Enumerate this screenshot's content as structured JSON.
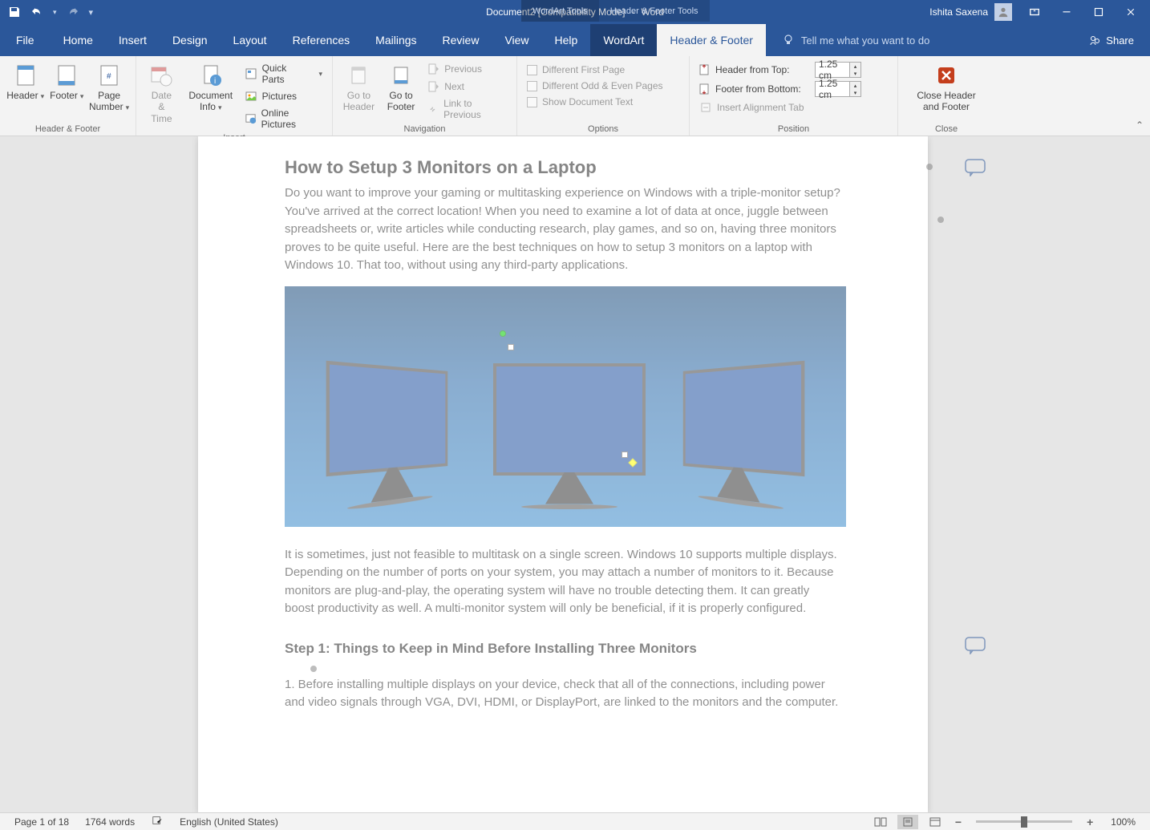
{
  "title": {
    "doc": "Document2 [Compatibility Mode]",
    "app": "Word",
    "sep": "-"
  },
  "context_tabs": {
    "wordart": "WordArt Tools",
    "headerfooter": "Header & Footer Tools"
  },
  "user": {
    "name": "Ishita Saxena"
  },
  "tabs": {
    "file": "File",
    "home": "Home",
    "insert": "Insert",
    "design": "Design",
    "layout": "Layout",
    "references": "References",
    "mailings": "Mailings",
    "review": "Review",
    "view": "View",
    "help": "Help",
    "wordart": "WordArt",
    "headerfooter": "Header & Footer",
    "tellme": "Tell me what you want to do",
    "share": "Share"
  },
  "ribbon": {
    "group_hf": {
      "label": "Header & Footer",
      "header": "Header",
      "footer": "Footer",
      "page_number": "Page\nNumber"
    },
    "group_insert": {
      "label": "Insert",
      "date_time": "Date &\nTime",
      "doc_info": "Document\nInfo",
      "quick_parts": "Quick Parts",
      "pictures": "Pictures",
      "online_pictures": "Online Pictures"
    },
    "group_nav": {
      "label": "Navigation",
      "goto_header": "Go to\nHeader",
      "goto_footer": "Go to\nFooter",
      "previous": "Previous",
      "next": "Next",
      "link_prev": "Link to Previous"
    },
    "group_options": {
      "label": "Options",
      "diff_first": "Different First Page",
      "diff_oe": "Different Odd & Even Pages",
      "show_doc": "Show Document Text"
    },
    "group_position": {
      "label": "Position",
      "header_from_top": "Header from Top:",
      "footer_from_bottom": "Footer from Bottom:",
      "header_val": "1.25 cm",
      "footer_val": "1.25 cm",
      "insert_align": "Insert Alignment Tab"
    },
    "group_close": {
      "label": "Close",
      "close": "Close Header\nand Footer"
    }
  },
  "document": {
    "h2": "How to Setup 3 Monitors on a Laptop",
    "p1": "Do you want to improve your gaming or multitasking experience on Windows with a triple-monitor setup? You've arrived at the correct location! When you need to examine a lot of data at once, juggle between spreadsheets or, write articles while conducting research, play games, and so on, having three monitors proves to be quite useful. Here are the best techniques on how to setup 3 monitors on a laptop with Windows 10. That too, without using any third-party applications.",
    "p2": "It is sometimes, just not feasible to multitask on a single screen. Windows 10 supports multiple displays. Depending on the number of ports on your system, you may attach a number of monitors to it. Because monitors are plug-and-play, the operating system will have no trouble detecting them. It can greatly boost productivity as well. A multi-monitor system will only be beneficial, if it is properly configured.",
    "h3": "Step 1: Things to Keep in Mind Before Installing Three Monitors",
    "p3": "1. Before installing multiple displays on your device, check that all of the connections, including power and video signals through VGA, DVI, HDMI, or DisplayPort, are linked to the monitors and the computer."
  },
  "status": {
    "page": "Page 1 of 18",
    "words": "1764 words",
    "lang": "English (United States)",
    "zoom": "100%"
  }
}
